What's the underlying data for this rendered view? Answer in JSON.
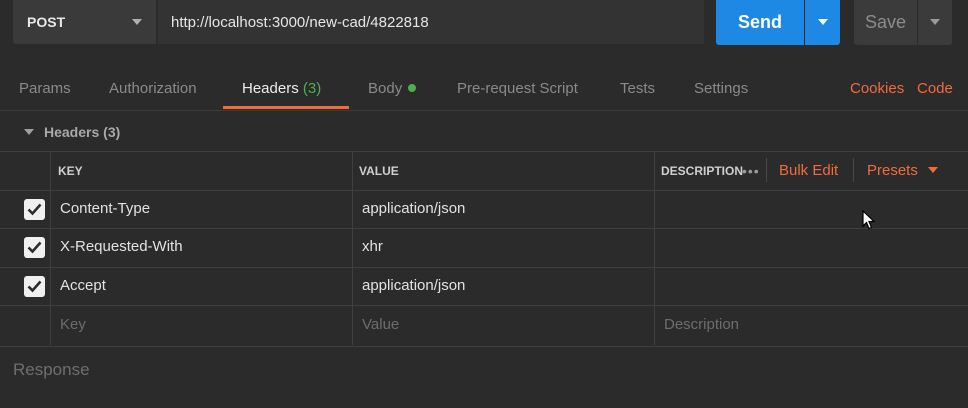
{
  "request": {
    "method": "POST",
    "url": "http://localhost:3000/new-cad/4822818",
    "send_label": "Send",
    "save_label": "Save"
  },
  "tabs": [
    {
      "label": "Params"
    },
    {
      "label": "Authorization"
    },
    {
      "label": "Headers",
      "count": "(3)"
    },
    {
      "label": "Body"
    },
    {
      "label": "Pre-request Script"
    },
    {
      "label": "Tests"
    },
    {
      "label": "Settings"
    }
  ],
  "links": {
    "cookies": "Cookies",
    "code": "Code"
  },
  "headers_section": {
    "title": "Headers",
    "count": "(3)",
    "columns": {
      "key": "KEY",
      "value": "VALUE",
      "description": "DESCRIPTION"
    },
    "more": "•••",
    "bulk_edit": "Bulk Edit",
    "presets": "Presets",
    "rows": [
      {
        "checked": true,
        "key": "Content-Type",
        "value": "application/json",
        "description": ""
      },
      {
        "checked": true,
        "key": "X-Requested-With",
        "value": "xhr",
        "description": ""
      },
      {
        "checked": true,
        "key": "Accept",
        "value": "application/json",
        "description": ""
      }
    ],
    "placeholders": {
      "key": "Key",
      "value": "Value",
      "description": "Description"
    }
  },
  "response": {
    "label": "Response"
  },
  "colors": {
    "accent": "#f26b3a",
    "send": "#1e88e5",
    "status_green": "#4caf50",
    "background": "#2b2b2b"
  }
}
